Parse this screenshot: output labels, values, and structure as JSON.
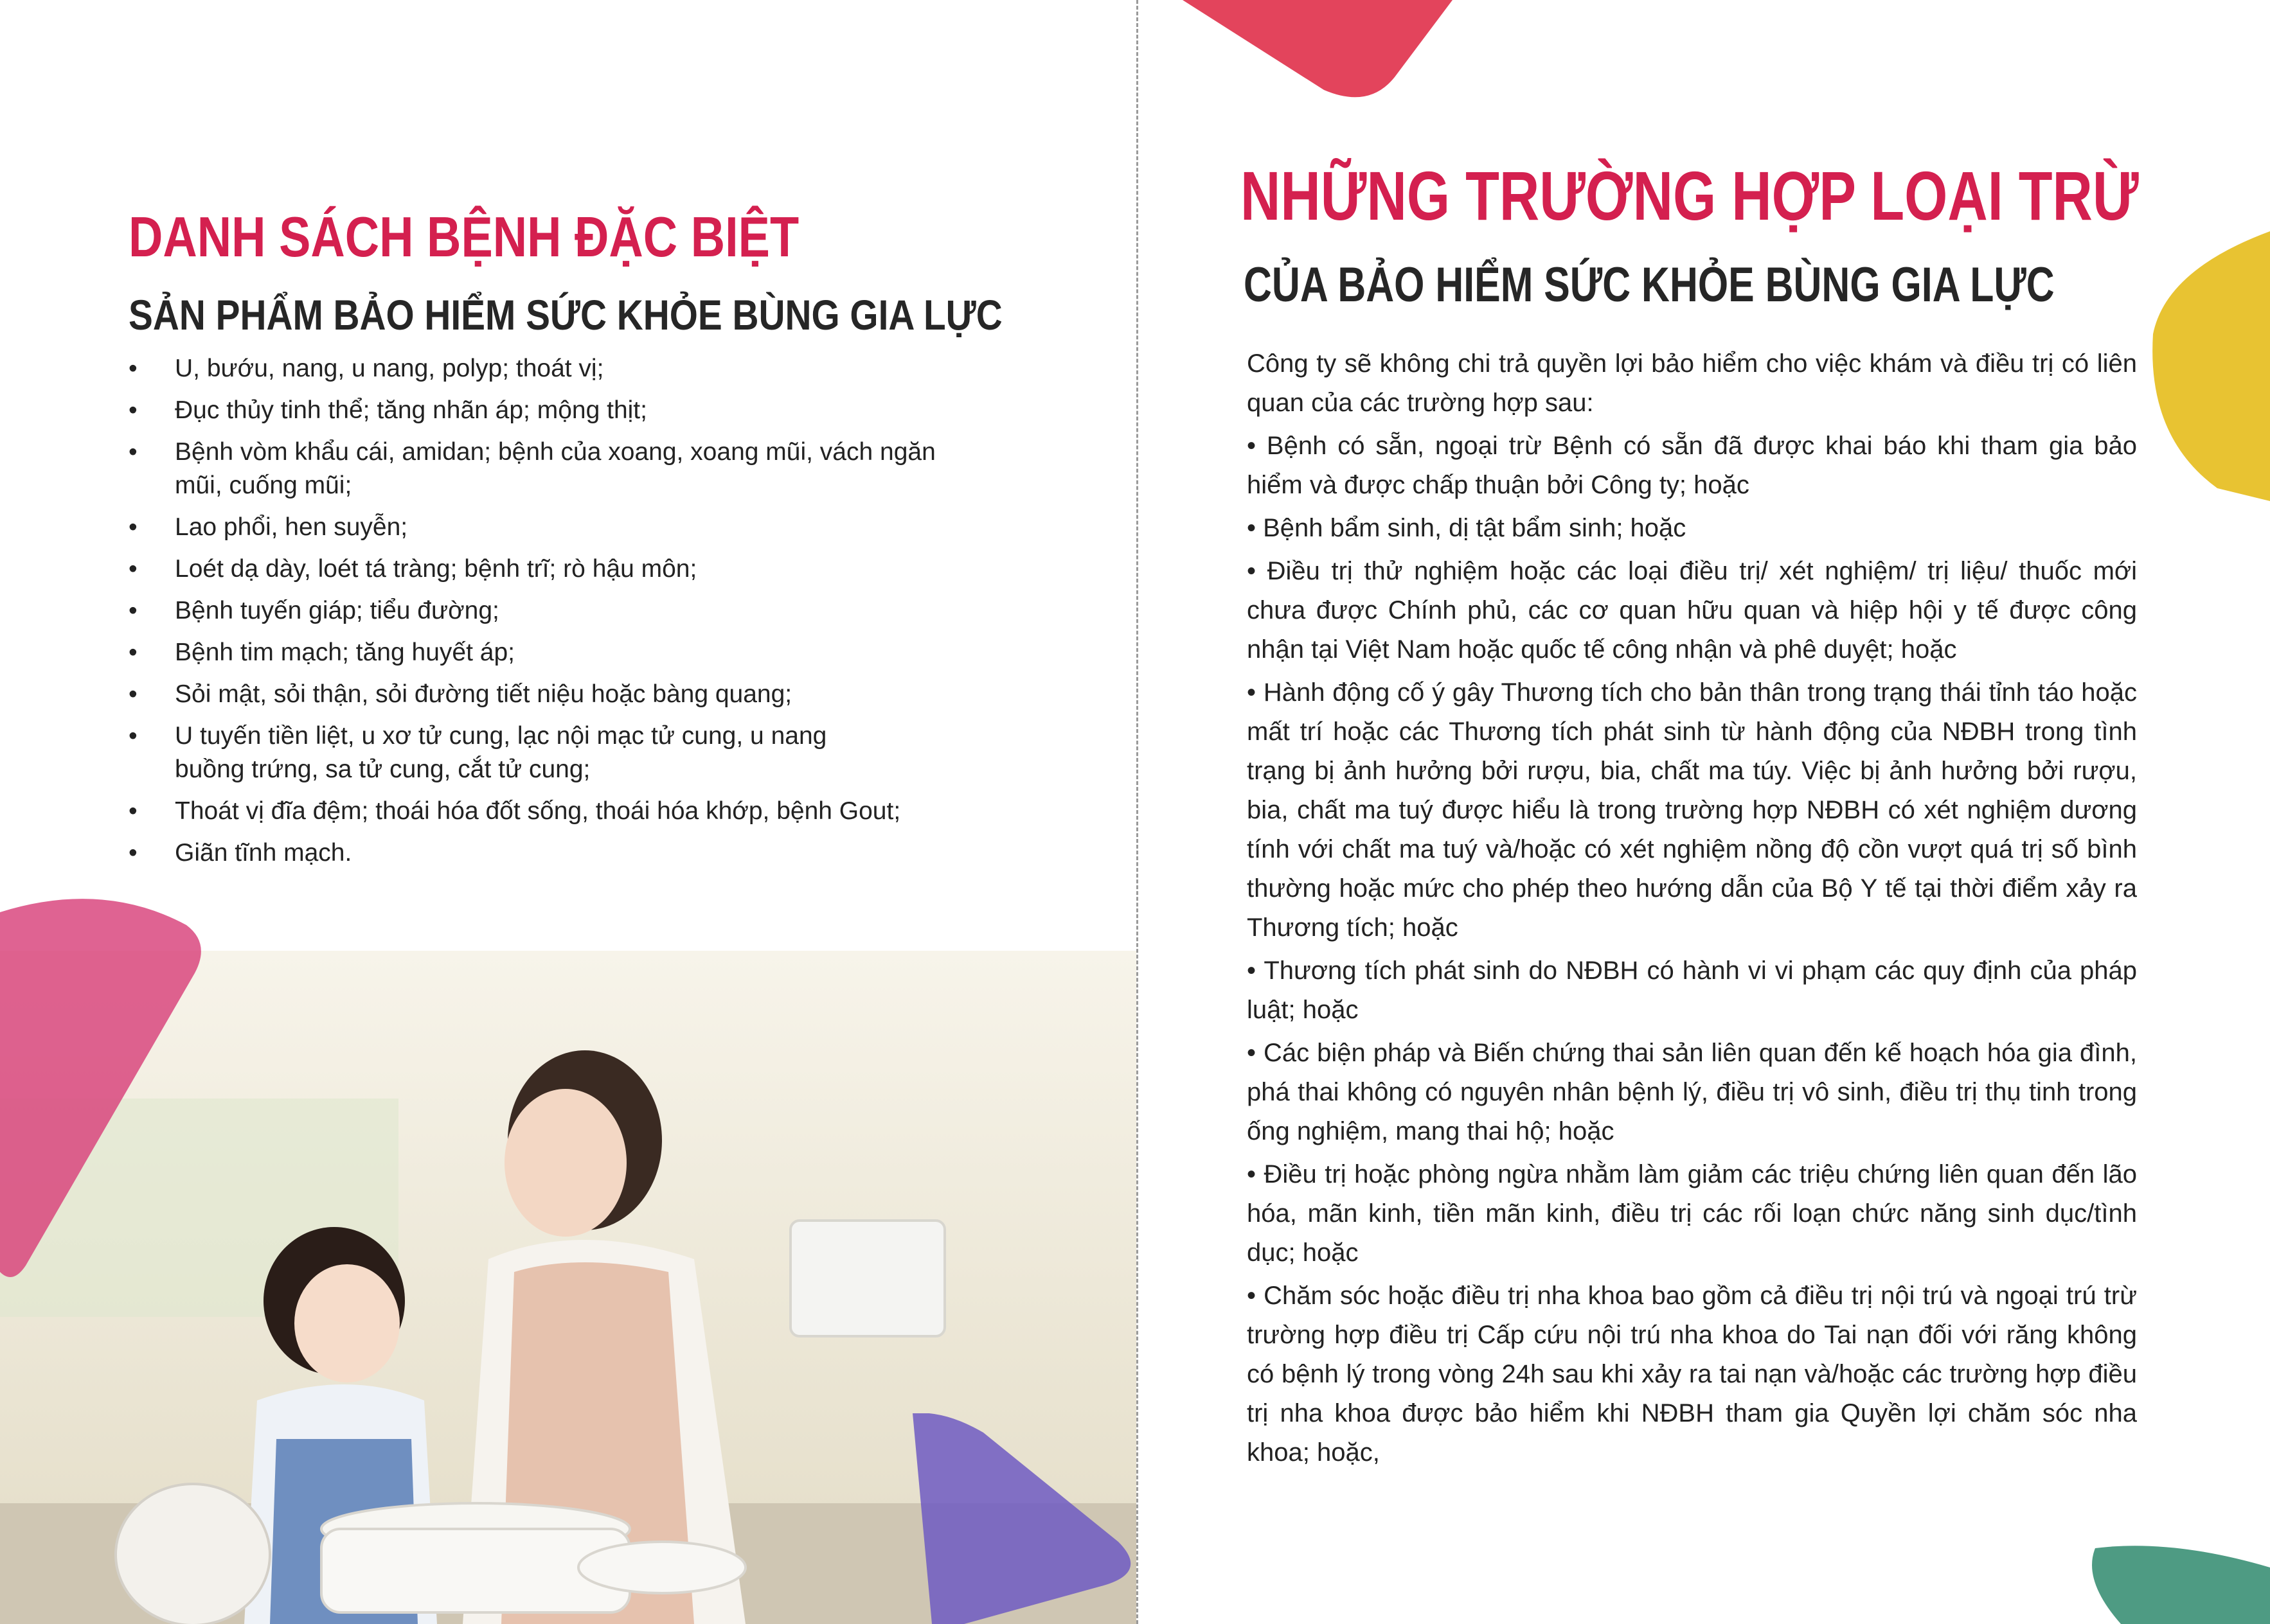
{
  "left": {
    "title": "DANH SÁCH BỆNH ĐẶC BIỆT",
    "subtitle": "SẢN PHẨM BẢO HIỂM SỨC KHỎE BÙNG GIA LỰC",
    "bullet": "•",
    "items": [
      {
        "line1": "U, bướu, nang, u nang, polyp; thoát vị;",
        "line2": ""
      },
      {
        "line1": "Đục thủy tinh thể; tăng nhãn áp; mộng thịt;",
        "line2": ""
      },
      {
        "line1": "Bệnh vòm khẩu cái, amidan; bệnh của xoang, xoang mũi, vách ngăn",
        "line2": "mũi, cuống mũi;"
      },
      {
        "line1": "Lao phổi, hen suyễn;",
        "line2": ""
      },
      {
        "line1": "Loét dạ dày, loét tá tràng; bệnh trĩ; rò hậu môn;",
        "line2": ""
      },
      {
        "line1": "Bệnh tuyến giáp; tiểu đường;",
        "line2": ""
      },
      {
        "line1": "Bệnh tim mạch; tăng huyết áp;",
        "line2": ""
      },
      {
        "line1": "Sỏi mật, sỏi thận, sỏi đường tiết niệu hoặc bàng quang;",
        "line2": ""
      },
      {
        "line1": "U tuyến tiền liệt, u xơ tử cung, lạc nội mạc tử cung, u nang",
        "line2": "buồng trứng, sa tử cung, cắt tử cung;"
      },
      {
        "line1": "Thoát vị đĩa đệm; thoái hóa đốt sống, thoái hóa khớp, bệnh Gout;",
        "line2": ""
      },
      {
        "line1": "Giãn tĩnh mạch.",
        "line2": ""
      }
    ]
  },
  "right": {
    "title": "NHỮNG TRƯỜNG HỢP LOẠI TRỪ",
    "subtitle": "CỦA BẢO HIỂM SỨC KHỎE BÙNG GIA LỰC",
    "intro": "Công ty sẽ không chi trả quyền lợi bảo hiểm cho việc khám và điều trị có liên quan của các trường hợp sau:",
    "items": [
      "• Bệnh có sẵn, ngoại trừ Bệnh có sẵn đã được khai báo khi tham gia bảo hiểm và được chấp thuận bởi Công ty; hoặc",
      "• Bệnh bẩm sinh, dị tật bẩm sinh; hoặc",
      "• Điều trị thử nghiệm hoặc các loại điều trị/ xét nghiệm/ trị liệu/ thuốc mới chưa được Chính phủ, các cơ quan hữu quan và hiệp hội y tế được công nhận tại Việt Nam hoặc quốc tế công nhận và phê duyệt; hoặc",
      "• Hành động cố ý gây Thương tích cho bản thân trong trạng thái tỉnh táo hoặc mất trí hoặc các Thương tích phát sinh từ hành động của NĐBH trong tình trạng bị ảnh hưởng bởi rượu, bia, chất ma túy. Việc bị ảnh hưởng bởi rượu, bia, chất ma tuý được hiểu là trong trường hợp NĐBH có xét nghiệm dương tính với chất ma tuý và/hoặc có xét nghiệm nồng độ cồn vượt quá trị số bình thường hoặc mức cho phép theo hướng dẫn của Bộ Y tế tại thời điểm xảy ra Thương tích; hoặc",
      "• Thương tích phát sinh do NĐBH có hành vi vi phạm các quy định của pháp luật; hoặc",
      "• Các biện pháp và Biến chứng thai sản liên quan đến kế hoạch hóa gia đình, phá thai không có nguyên nhân bệnh lý, điều trị vô sinh, điều trị thụ tinh trong ống nghiệm, mang thai hộ; hoặc",
      "• Điều trị hoặc phòng ngừa nhằm làm giảm các triệu chứng liên quan đến lão hóa, mãn kinh, tiền mãn kinh, điều trị các rối loạn chức năng sinh dục/tình dục; hoặc",
      "• Chăm sóc hoặc điều trị nha khoa bao gồm cả điều trị nội trú và ngoại trú trừ trường hợp điều trị Cấp cứu nội trú nha khoa do Tai nạn đối với răng không có bệnh lý trong vòng 24h sau khi xảy ra tai nạn và/hoặc các trường hợp điều trị nha khoa được bảo hiểm khi NĐBH tham gia Quyền lợi chăm sóc nha khoa; hoặc,"
    ]
  },
  "colors": {
    "title_red": "#d4204f",
    "title_dark": "#262626",
    "shape_red": "#e0304a",
    "shape_pink": "#d8417a",
    "shape_yellow": "#e5bd1c",
    "shape_purple": "#6e5bc2",
    "shape_green": "#2f8a6d"
  },
  "icons": [
    "bullet-dot-icon"
  ]
}
